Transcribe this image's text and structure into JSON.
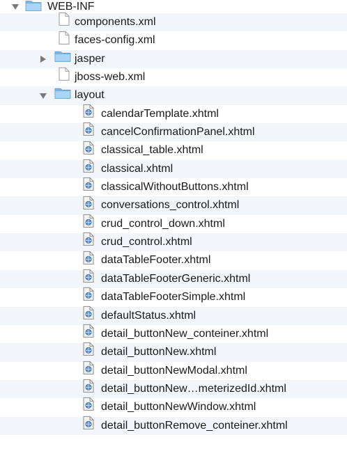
{
  "tree": {
    "root": {
      "name": "WEB-INF",
      "expanded": true
    },
    "level1": [
      {
        "name": "components.xml",
        "kind": "file"
      },
      {
        "name": "faces-config.xml",
        "kind": "file"
      },
      {
        "name": "jasper",
        "kind": "folder",
        "expanded": false
      },
      {
        "name": "jboss-web.xml",
        "kind": "file"
      },
      {
        "name": "layout",
        "kind": "folder",
        "expanded": true
      }
    ],
    "layout_files": [
      "calendarTemplate.xhtml",
      "cancelConfirmationPanel.xhtml",
      "classical_table.xhtml",
      "classical.xhtml",
      "classicalWithoutButtons.xhtml",
      "conversations_control.xhtml",
      "crud_control_down.xhtml",
      "crud_control.xhtml",
      "dataTableFooter.xhtml",
      "dataTableFooterGeneric.xhtml",
      "dataTableFooterSimple.xhtml",
      "defaultStatus.xhtml",
      "detail_buttonNew_conteiner.xhtml",
      "detail_buttonNew.xhtml",
      "detail_buttonNewModal.xhtml",
      "detail_buttonNew…meterizedId.xhtml",
      "detail_buttonNewWindow.xhtml",
      "detail_buttonRemove_conteiner.xhtml"
    ]
  },
  "icons": {
    "disclosure_open": "triangle-down-icon",
    "disclosure_closed": "triangle-right-icon",
    "folder": "folder-icon",
    "file": "document-icon",
    "xhtml_file": "xhtml-document-icon"
  },
  "colors": {
    "alt_row": "#f2f5fa",
    "folder_blue": "#8fc4ec",
    "disclosure_gray": "#7a7a7a",
    "text": "#1a1a1a"
  }
}
